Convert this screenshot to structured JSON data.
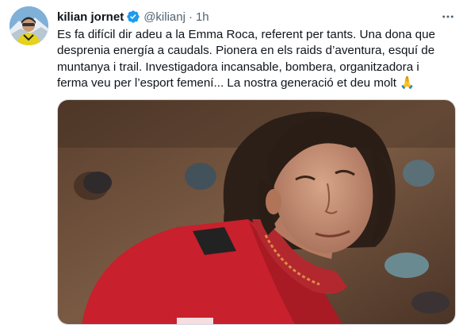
{
  "tweet": {
    "display_name": "kilian jornet",
    "handle": "@kilianj",
    "separator": "·",
    "timestamp": "1h",
    "verified": true,
    "text": "Es fa difícil dir adeu a la Emma Roca, referent per tants. Una dona que desprenia energía a caudals. Pionera en els raids d’aventura, esquí de muntanya i trail. Investigadora incansable, bombera, organitzadora i ferma veu per l’esport femení... La nostra generació et deu molt 🙏",
    "media": {
      "type": "photo"
    }
  },
  "icons": {
    "verified": "verified-badge-icon",
    "more": "more-options-icon"
  },
  "colors": {
    "text_primary": "#0f1419",
    "text_secondary": "#536471",
    "verified_blue": "#1d9bf0",
    "jacket_red": "#c8202c"
  }
}
